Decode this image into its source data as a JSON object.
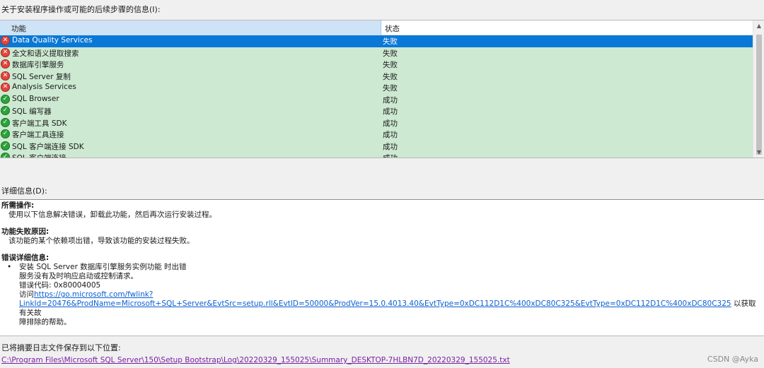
{
  "top_label": "关于安装程序操作或可能的后续步骤的信息(I):",
  "list": {
    "headers": {
      "feature": "功能",
      "status": "状态"
    },
    "rows": [
      {
        "name": "Data Quality Services",
        "status": "失败",
        "result": "fail",
        "selected": true
      },
      {
        "name": "全文和语义提取搜索",
        "status": "失败",
        "result": "fail"
      },
      {
        "name": "数据库引擎服务",
        "status": "失败",
        "result": "fail"
      },
      {
        "name": "SQL Server 复制",
        "status": "失败",
        "result": "fail"
      },
      {
        "name": "Analysis Services",
        "status": "失败",
        "result": "fail"
      },
      {
        "name": "SQL Browser",
        "status": "成功",
        "result": "ok"
      },
      {
        "name": "SQL 编写器",
        "status": "成功",
        "result": "ok"
      },
      {
        "name": "客户端工具 SDK",
        "status": "成功",
        "result": "ok"
      },
      {
        "name": "客户端工具连接",
        "status": "成功",
        "result": "ok"
      },
      {
        "name": "SQL 客户端连接 SDK",
        "status": "成功",
        "result": "ok"
      },
      {
        "name": "SQL 客户端连接",
        "status": "成功",
        "result": "ok"
      }
    ]
  },
  "details": {
    "label": "详细信息(D):",
    "required_action_title": "所需操作:",
    "required_action_text": "使用以下信息解决错误，卸载此功能，然后再次运行安装过程。",
    "failure_reason_title": "功能失败原因:",
    "failure_reason_text": "该功能的某个依赖项出错，导致该功能的安装过程失败。",
    "error_details_title": "错误详细信息:",
    "bullet": "•",
    "error_line1": "安装 SQL Server 数据库引擎服务实例功能 时出错",
    "error_line2": "服务没有及时响应启动或控制请求。",
    "error_code": "错误代码: 0x80004005",
    "visit_prefix": "访问",
    "help_url": "https://go.microsoft.com/fwlink?LinkId=20476&ProdName=Microsoft+SQL+Server&EvtSrc=setup.rll&EvtID=50000&ProdVer=15.0.4013.40&EvtType=0xDC112D1C%400xDC80C325&EvtType=0xDC112D1C%400xDC80C325",
    "visit_suffix": "以获取有关故",
    "visit_suffix2": "障排除的帮助。"
  },
  "log": {
    "label": "已将摘要日志文件保存到以下位置:",
    "path": "C:\\Program Files\\Microsoft SQL Server\\150\\Setup Bootstrap\\Log\\20220329_155025\\Summary_DESKTOP-7HLBN7D_20220329_155025.txt"
  },
  "watermark": "CSDN @Ayka",
  "icons": {
    "fail": "error-x-icon",
    "ok": "checkmark-icon"
  },
  "colors": {
    "row_bg": "#cde9d2",
    "selected_bg": "#0a78d7",
    "fail": "#e0453c",
    "ok": "#2ea23a",
    "link": "#0b5fd1",
    "visited_link": "#7b1fa2"
  }
}
